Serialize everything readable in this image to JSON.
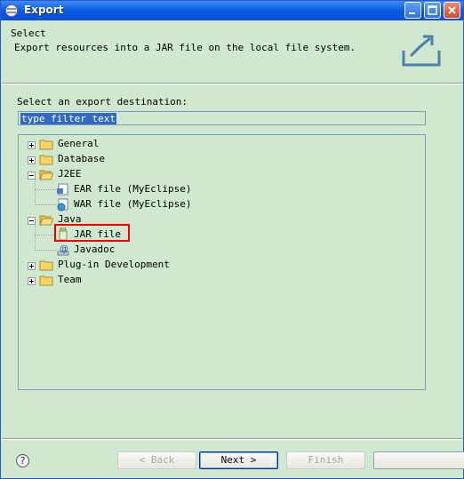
{
  "window": {
    "title": "Export"
  },
  "banner": {
    "title": "Select",
    "description": "Export resources into a JAR file on the local file system."
  },
  "destination": {
    "label": "Select an export destination:"
  },
  "filter": {
    "value": "type filter text"
  },
  "tree": {
    "items": [
      {
        "label": "General",
        "expanded": false,
        "icon": "folder-icon"
      },
      {
        "label": "Database",
        "expanded": false,
        "icon": "folder-icon"
      },
      {
        "label": "J2EE",
        "expanded": true,
        "icon": "folder-open-icon",
        "children": [
          {
            "label": "EAR file (MyEclipse)",
            "icon": "ear-file-icon"
          },
          {
            "label": "WAR file (MyEclipse)",
            "icon": "war-file-icon"
          }
        ]
      },
      {
        "label": "Java",
        "expanded": true,
        "icon": "folder-open-icon",
        "children": [
          {
            "label": "JAR file",
            "icon": "jar-file-icon"
          },
          {
            "label": "Javadoc",
            "icon": "javadoc-icon"
          }
        ]
      },
      {
        "label": "Plug-in Development",
        "expanded": false,
        "icon": "folder-icon"
      },
      {
        "label": "Team",
        "expanded": false,
        "icon": "folder-icon"
      }
    ]
  },
  "buttons": {
    "help": "?",
    "back": "< Back",
    "next": "Next >",
    "finish": "Finish",
    "cancel": ""
  },
  "colors": {
    "highlight": "#e00000",
    "selection": "#316ac5",
    "background": "#cfe8cf"
  }
}
